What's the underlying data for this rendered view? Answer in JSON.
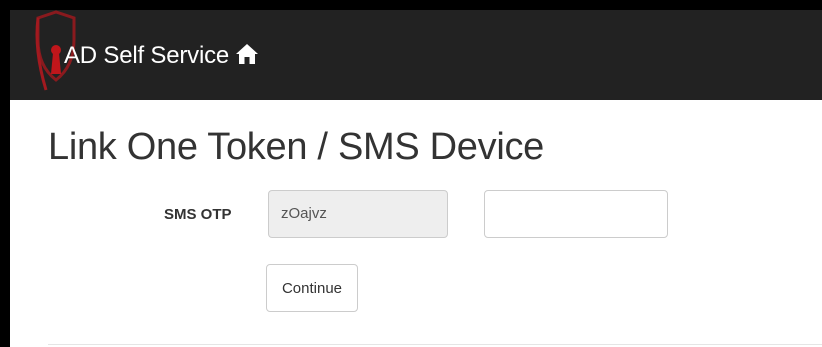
{
  "header": {
    "brand_label": "AD Self Service",
    "home_icon": "home-icon",
    "logo_icon": "shield-keyhole-logo"
  },
  "page": {
    "title": "Link One Token / SMS Device"
  },
  "form": {
    "sms_otp_label": "SMS OTP",
    "sms_otp_readonly_value": "zOajvz",
    "sms_otp_input_value": "",
    "continue_label": "Continue"
  },
  "colors": {
    "navbar_bg": "#222222",
    "logo_red": "#c0161b",
    "readonly_bg": "#eeeeee"
  }
}
